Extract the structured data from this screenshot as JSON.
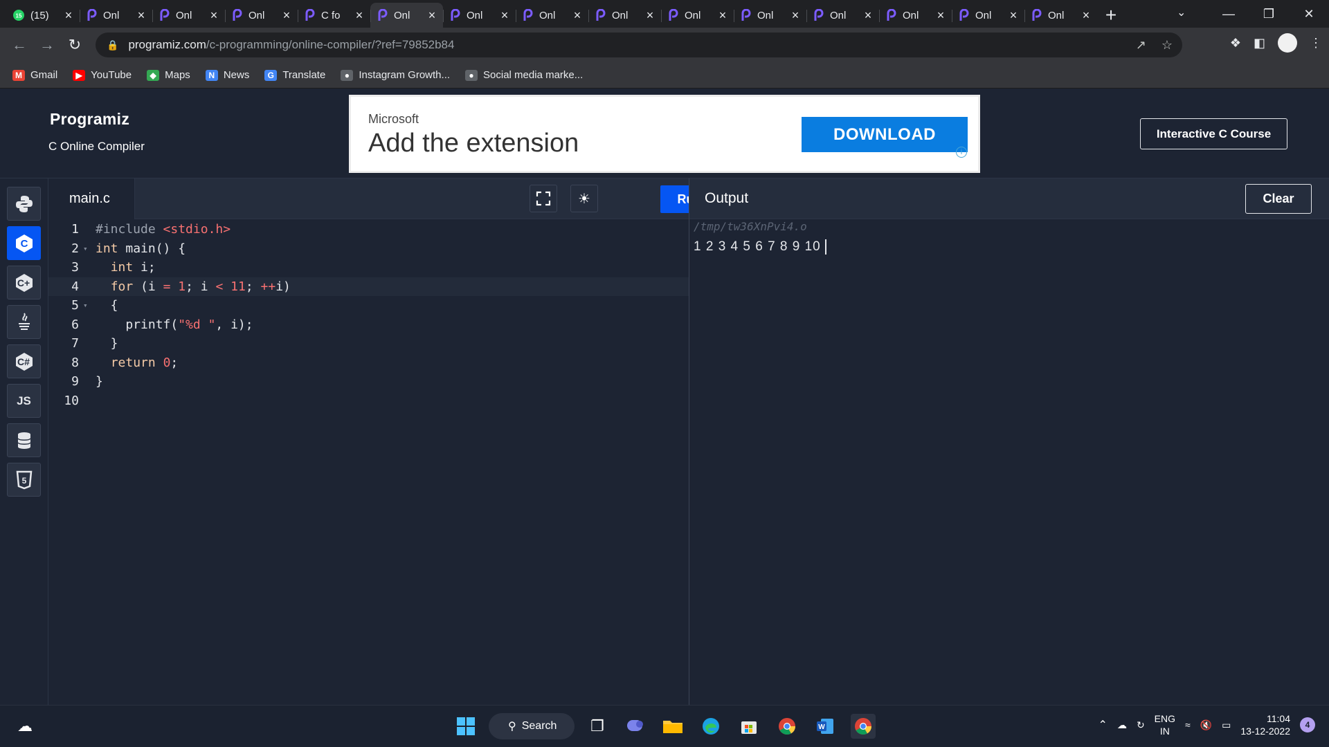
{
  "browser": {
    "tabs": [
      {
        "label": "(15)",
        "icon": "whatsapp-icon",
        "active": false
      },
      {
        "label": "Onl",
        "icon": "programiz-icon",
        "active": false
      },
      {
        "label": "Onl",
        "icon": "programiz-icon",
        "active": false
      },
      {
        "label": "Onl",
        "icon": "programiz-icon",
        "active": false
      },
      {
        "label": "C fo",
        "icon": "programiz-icon",
        "active": false
      },
      {
        "label": "Onl",
        "icon": "programiz-icon",
        "active": true
      },
      {
        "label": "Onl",
        "icon": "programiz-icon",
        "active": false
      },
      {
        "label": "Onl",
        "icon": "programiz-icon",
        "active": false
      },
      {
        "label": "Onl",
        "icon": "programiz-icon",
        "active": false
      },
      {
        "label": "Onl",
        "icon": "programiz-icon",
        "active": false
      },
      {
        "label": "Onl",
        "icon": "programiz-icon",
        "active": false
      },
      {
        "label": "Onl",
        "icon": "programiz-icon",
        "active": false
      },
      {
        "label": "Onl",
        "icon": "programiz-icon",
        "active": false
      },
      {
        "label": "Onl",
        "icon": "programiz-icon",
        "active": false
      },
      {
        "label": "Onl",
        "icon": "programiz-icon",
        "active": false
      }
    ],
    "url_host": "programiz.com",
    "url_path": "/c-programming/online-compiler/?ref=79852b84",
    "bookmarks": [
      {
        "label": "Gmail",
        "icon": "gmail-icon"
      },
      {
        "label": "YouTube",
        "icon": "youtube-icon"
      },
      {
        "label": "Maps",
        "icon": "maps-icon"
      },
      {
        "label": "News",
        "icon": "news-icon"
      },
      {
        "label": "Translate",
        "icon": "translate-icon"
      },
      {
        "label": "Instagram Growth...",
        "icon": "globe-icon"
      },
      {
        "label": "Social media marke...",
        "icon": "globe-icon"
      }
    ]
  },
  "header": {
    "logo": "Programiz",
    "subtitle": "C Online Compiler",
    "course_button": "Interactive C Course"
  },
  "ad": {
    "brand": "Microsoft",
    "headline": "Add the extension",
    "cta": "DOWNLOAD"
  },
  "editor": {
    "filename": "main.c",
    "run_label": "Run",
    "lines": [
      {
        "n": "1",
        "fold": false
      },
      {
        "n": "2",
        "fold": true
      },
      {
        "n": "3",
        "fold": false
      },
      {
        "n": "4",
        "fold": false
      },
      {
        "n": "5",
        "fold": true
      },
      {
        "n": "6",
        "fold": false
      },
      {
        "n": "7",
        "fold": false
      },
      {
        "n": "8",
        "fold": false
      },
      {
        "n": "9",
        "fold": false
      },
      {
        "n": "10",
        "fold": false
      }
    ],
    "code": {
      "l1_a": "#include ",
      "l1_b": "<stdio.h>",
      "l2": "int main() {",
      "l3": "  int i;",
      "l4_a": "  for (i ",
      "l4_b": "=",
      "l4_c": " ",
      "l4_d": "1",
      "l4_e": "; i ",
      "l4_f": "<",
      "l4_g": " ",
      "l4_h": "11",
      "l4_i": "; ",
      "l4_j": "++",
      "l4_k": "i)",
      "l5": "  {",
      "l6_a": "    printf(",
      "l6_b": "\"%d \"",
      "l6_c": ", i);",
      "l7": "  }",
      "l8_a": "  return ",
      "l8_b": "0",
      "l8_c": ";",
      "l9": "}",
      "l10": ""
    }
  },
  "output": {
    "title": "Output",
    "clear_label": "Clear",
    "path": "/tmp/tw36XnPvi4.o",
    "text": "1 2 3 4 5 6 7 8 9 10"
  },
  "taskbar": {
    "search_label": "Search",
    "lang_top": "ENG",
    "lang_bottom": "IN",
    "time": "11:04",
    "date": "13-12-2022",
    "notifications": "4"
  }
}
